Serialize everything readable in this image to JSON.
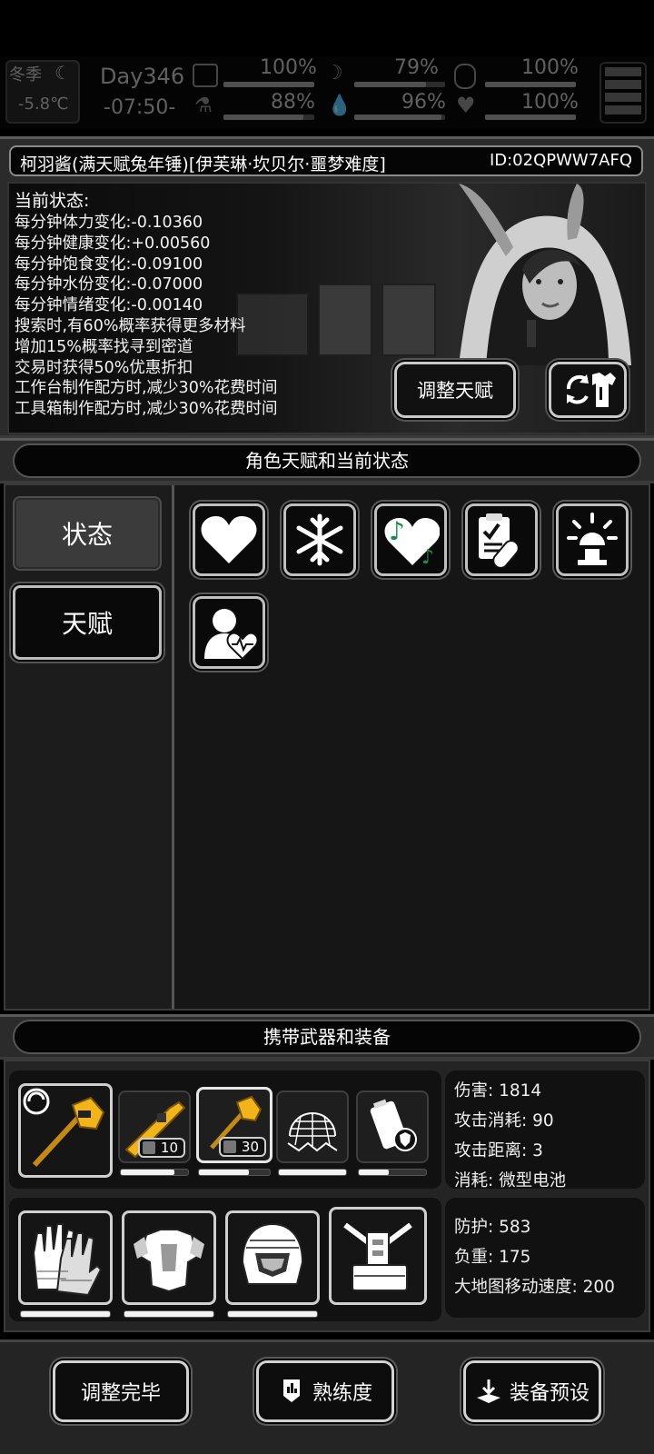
{
  "top_status": {
    "season": "冬季",
    "temperature": "-5.8℃",
    "day": "Day346",
    "time": "-07:50-",
    "stats": [
      {
        "name": "health",
        "icon": "medkit-icon",
        "value": "100%",
        "fill": 1.0
      },
      {
        "name": "mood",
        "icon": "moon-icon",
        "value": "79%",
        "fill": 0.79
      },
      {
        "name": "hunger",
        "icon": "stomach-icon",
        "value": "100%",
        "fill": 1.0
      },
      {
        "name": "food",
        "icon": "flask-icon",
        "value": "88%",
        "fill": 0.88
      },
      {
        "name": "water",
        "icon": "water-drop-icon",
        "value": "96%",
        "fill": 0.96
      },
      {
        "name": "heart",
        "icon": "heart-icon",
        "value": "100%",
        "fill": 1.0
      }
    ]
  },
  "character": {
    "name": "柯羽酱(满天赋兔年锤)[伊芙琳·坎贝尔·噩梦难度]",
    "id": "ID:02QPWW7AFQ"
  },
  "status_panel": {
    "title": "当前状态:",
    "lines": [
      "每分钟体力变化:-0.10360",
      "每分钟健康变化:+0.00560",
      "每分钟饱食变化:-0.09100",
      "每分钟水份变化:-0.07000",
      "每分钟情绪变化:-0.00140",
      "搜索时,有60%概率获得更多材料",
      "增加15%概率找寻到密道",
      "交易时获得50%优惠折扣",
      "工作台制作配方时,减少30%花费时间",
      "工具箱制作配方时,减少30%花费时间"
    ],
    "adjust_talent_label": "调整天赋",
    "outfit_button_icon": "outfit-swap-icon"
  },
  "talent_section": {
    "header": "角色天赋和当前状态",
    "tabs": [
      {
        "label": "状态",
        "active": true
      },
      {
        "label": "天赋",
        "active": false
      }
    ],
    "status_icons": [
      "heart-icon",
      "snowflake-icon",
      "music-heart-icon",
      "medicine-clipboard-icon",
      "alarm-light-icon",
      "health-monitor-person-icon"
    ]
  },
  "equipment_section": {
    "header": "携带武器和装备",
    "weapons": [
      {
        "icon": "golden-hammer-icon",
        "durability": 1.0
      },
      {
        "icon": "golden-rifle-icon",
        "count": "10",
        "durability": 0.8
      },
      {
        "icon": "golden-hammer-small-icon",
        "count": "30",
        "durability": 0.7
      },
      {
        "icon": "net-trap-icon",
        "durability": 1.0
      },
      {
        "icon": "battery-shield-icon",
        "durability": 0.45
      }
    ],
    "weapon_stats": [
      "伤害: 1814",
      "攻击消耗: 90",
      "攻击距离: 3",
      "消耗: 微型电池"
    ],
    "armor": [
      {
        "icon": "gloves-icon",
        "durability": 1.0
      },
      {
        "icon": "chest-armor-icon",
        "durability": 1.0
      },
      {
        "icon": "helmet-icon",
        "durability": 1.0
      },
      {
        "icon": "backpack-frame-icon",
        "durability": 0
      }
    ],
    "armor_stats": [
      "防护: 583",
      "负重: 175",
      "大地图移动速度: 200"
    ]
  },
  "bottom_buttons": {
    "done": "调整完毕",
    "proficiency": "熟练度",
    "preset": "装备预设"
  }
}
